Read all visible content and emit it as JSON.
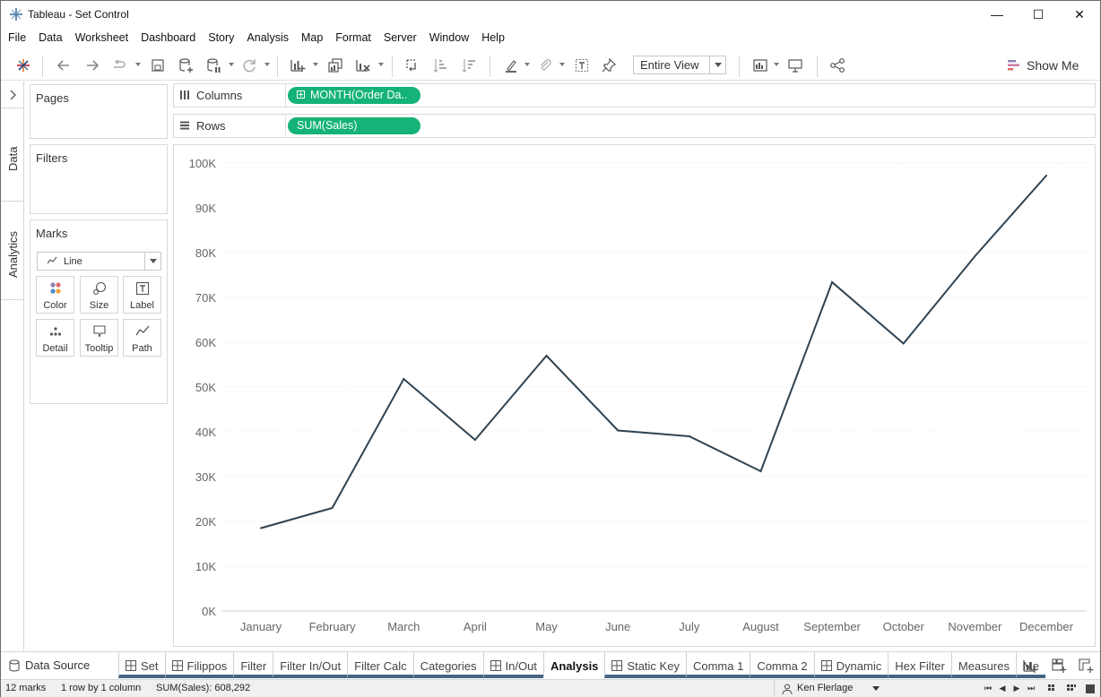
{
  "window": {
    "title": "Tableau - Set Control",
    "minimize": "—",
    "maximize": "☐",
    "close": "✕"
  },
  "menu": [
    "File",
    "Data",
    "Worksheet",
    "Dashboard",
    "Story",
    "Analysis",
    "Map",
    "Format",
    "Server",
    "Window",
    "Help"
  ],
  "toolbar": {
    "fit_select": "Entire View",
    "show_me": "Show Me",
    "icons": [
      "tableau-logo-icon",
      "undo-icon",
      "redo-icon",
      "replay-icon",
      "save-icon",
      "new-data-source-icon",
      "pause-updates-icon",
      "refresh-icon",
      "new-worksheet-icon",
      "duplicate-sheet-icon",
      "clear-sheet-icon",
      "swap-rows-columns-icon",
      "sort-ascending-icon",
      "sort-descending-icon",
      "highlight-icon",
      "group-icon",
      "show-labels-icon",
      "pin-icon",
      "show-cards-icon",
      "presentation-icon",
      "share-icon"
    ]
  },
  "side_tabs": {
    "data": "Data",
    "analytics": "Analytics"
  },
  "cards": {
    "pages": "Pages",
    "filters": "Filters",
    "marks": "Marks",
    "mark_type": "Line",
    "mark_buttons": [
      "Color",
      "Size",
      "Label",
      "Detail",
      "Tooltip",
      "Path"
    ]
  },
  "shelves": {
    "columns_label": "Columns",
    "columns_pill": "MONTH(Order Da..",
    "rows_label": "Rows",
    "rows_pill": "SUM(Sales)"
  },
  "chart_data": {
    "type": "line",
    "categories": [
      "January",
      "February",
      "March",
      "April",
      "May",
      "June",
      "July",
      "August",
      "September",
      "October",
      "November",
      "December"
    ],
    "series": [
      {
        "values": [
          18500,
          23000,
          51800,
          38200,
          57000,
          40300,
          39000,
          31200,
          73400,
          59700,
          79200,
          97200
        ],
        "color": "#2f4352"
      }
    ],
    "yticks": [
      "100K",
      "90K",
      "80K",
      "70K",
      "60K",
      "50K",
      "40K",
      "30K",
      "20K",
      "10K",
      "0K"
    ],
    "ylim": [
      0,
      100000
    ],
    "grid": true,
    "xlabel": "",
    "ylabel": ""
  },
  "bottom_tabs": {
    "data_source": "Data Source",
    "sheets": [
      "Set",
      "Filippos",
      "Filter",
      "Filter In/Out",
      "Filter Calc",
      "Categories",
      "In/Out",
      "Analysis",
      "Static Key",
      "Comma 1",
      "Comma 2",
      "Dynamic",
      "Hex Filter",
      "Measures",
      "Me"
    ],
    "sheet_has_grid_icon": [
      true,
      true,
      false,
      false,
      false,
      false,
      true,
      false,
      true,
      false,
      false,
      true,
      false,
      false,
      false
    ],
    "active": "Analysis"
  },
  "status": {
    "marks": "12 marks",
    "dims": "1 row by 1 column",
    "sum": "SUM(Sales): 608,292",
    "user": "Ken Flerlage"
  }
}
